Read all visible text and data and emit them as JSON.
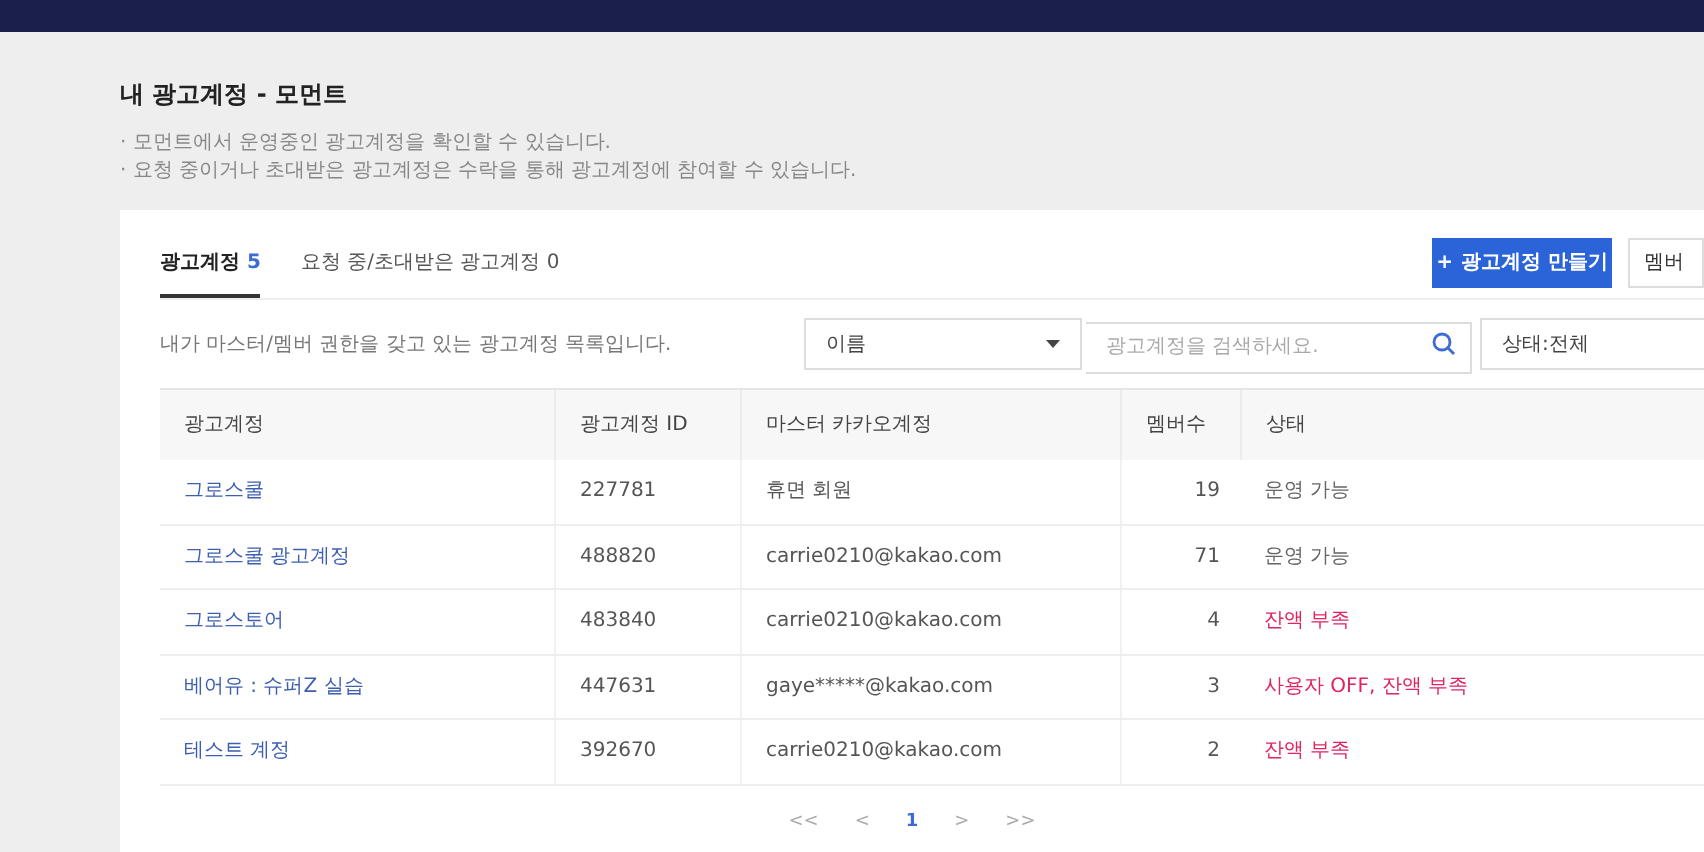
{
  "page": {
    "title": "내 광고계정 - 모먼트",
    "bullet": "·",
    "notes": [
      "모먼트에서 운영중인 광고계정을 확인할 수 있습니다.",
      "요청 중이거나 초대받은 광고계정은 수락을 통해 광고계정에 참여할 수 있습니다."
    ]
  },
  "tabs": [
    {
      "label": "광고계정",
      "count": "5",
      "selected": true
    },
    {
      "label": "요청 중/초대받은 광고계정",
      "count": "0",
      "selected": false
    }
  ],
  "buttons": {
    "create": "광고계정 만들기",
    "create_icon": "+",
    "member": "멤버"
  },
  "description": "내가 마스터/멤버 권한을 갖고 있는 광고계정 목록입니다.",
  "filter": {
    "field": "이름",
    "search_placeholder": "광고계정을 검색하세요.",
    "status": "상태:전체"
  },
  "table": {
    "columns": [
      "광고계정",
      "광고계정 ID",
      "마스터 카카오계정",
      "멤버수",
      "상태"
    ],
    "rows": [
      {
        "name": "그로스쿨",
        "id": "227781",
        "master": "휴면 회원",
        "members": "19",
        "status": "운영 가능",
        "kind": "normal"
      },
      {
        "name": "그로스쿨 광고계정",
        "id": "488820",
        "master": "carrie0210@kakao.com",
        "members": "71",
        "status": "운영 가능",
        "kind": "normal"
      },
      {
        "name": "그로스토어",
        "id": "483840",
        "master": "carrie0210@kakao.com",
        "members": "4",
        "status": "잔액 부족",
        "kind": "alert"
      },
      {
        "name": "베어유 : 슈퍼Z 실습",
        "id": "447631",
        "master": "gaye*****@kakao.com",
        "members": "3",
        "status": "사용자 OFF, 잔액 부족",
        "kind": "alert"
      },
      {
        "name": "테스트 계정",
        "id": "392670",
        "master": "carrie0210@kakao.com",
        "members": "2",
        "status": "잔액 부족",
        "kind": "alert"
      }
    ]
  },
  "pagination": {
    "first": "<<",
    "prev": "<",
    "pages": [
      {
        "label": "1",
        "selected": true
      }
    ],
    "next": ">",
    "last": ">>"
  }
}
